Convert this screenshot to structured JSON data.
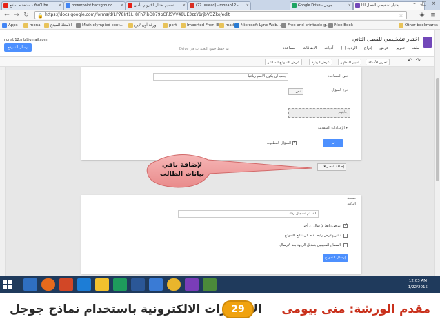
{
  "browser": {
    "tabs": [
      {
        "label": "إختبار تشخيصي للفصل الثا...",
        "active": true,
        "color": "#7248b9"
      },
      {
        "label": "Google Drive - جوجل",
        "active": false,
        "color": "#1fa463"
      },
      {
        "label": "(27 unread) - monab12 - ",
        "active": false,
        "color": "#d93025"
      },
      {
        "label": "تصميم اختبار الكتروني بأمان",
        "active": false,
        "color": "#e62117"
      },
      {
        "label": "powerpoint background",
        "active": false,
        "color": "#4285f4"
      },
      {
        "label": "استخدام نماذج - YouTube",
        "active": false,
        "color": "#e62117"
      }
    ],
    "url": "https://docs.google.com/forms/d/1P78Irt1L_8Fh7ibD879pCRlSVV48UE3zzY1rjbVDZko/edit",
    "bookmarks": [
      "Apps",
      "mona",
      "الاستاذ المبدع",
      "Math olympied cont...",
      "ورقة أون لاين",
      "port",
      "Imported From IE",
      "math",
      "Microsoft Lync Web...",
      "Free and printable g...",
      "Moe Book"
    ],
    "other_bookmarks": "Other bookmarks"
  },
  "forms": {
    "account": "monab12.mb@gmail.com",
    "send_form": "إرسال النموذج",
    "title": "اختبار تشخيصي للفصل الثاني",
    "menu": [
      "ملف",
      "تحرير",
      "عرض",
      "إدراج",
      "الردود (٠)",
      "أدوات",
      "الإضافات",
      "مساعدة"
    ],
    "save_note": "تم حفظ جميع التغييرات في Drive",
    "toolbar": {
      "edit_questions": "تحرير الأسئلة",
      "change_theme": "تغيير المظهر",
      "view_responses": "عرض الردود",
      "view_live_form": "عرض النموذج المباشر"
    }
  },
  "question": {
    "help_text_label": "نص المساعدة",
    "help_text_value": "يجب أن يكون الاسم رباعيا",
    "type_label": "نوع السؤال",
    "type_value": "نص",
    "answer_label": "أمثلة",
    "answer_placeholder": "إجابتهم",
    "advanced": "▸ الإعدادات المتقدمة",
    "required": "السؤال المطلوب",
    "done": "تم"
  },
  "add_item": "إضافة عنصر",
  "callout": {
    "line1": "لإضافة باقي",
    "line2": "بيانات الطالب"
  },
  "confirmation": {
    "heading": "صفحة",
    "subheading": "التأكيد",
    "message": "لقد تم تسجيل ردك.",
    "options": [
      {
        "label": "عرض رابط لإرسال رد آخر",
        "checked": true
      },
      {
        "label": "نشر وعرض رابط عام إلى نتائج النموذج",
        "checked": false
      },
      {
        "label": "السماح للمجيبين بتعديل الردود بعد الإرسال",
        "checked": false
      }
    ],
    "send": "إرسال النموذج"
  },
  "taskbar": {
    "time": "12:03 AM",
    "date": "1/22/2015"
  },
  "footer": {
    "left": "الاختبارات الالكترونية باستخدام نماذج جوجل",
    "page": "29",
    "right": "مقدم الورشة: منى بيومى"
  }
}
